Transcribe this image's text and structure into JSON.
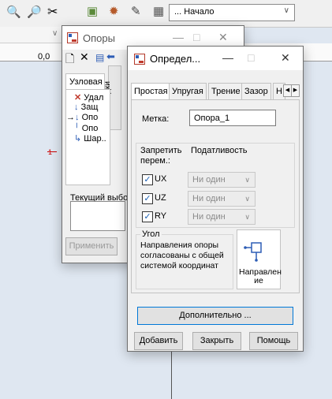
{
  "app": {
    "top_combo_value": "... Начало",
    "ruler_origin": "0,0",
    "axis_marker": "1"
  },
  "opory_window": {
    "title": "Опоры",
    "tab_label": "Узловая",
    "side_tab_label": "вкладки",
    "tree_items": [
      "Удал",
      "Защ",
      "Опо",
      "Опо",
      "Шар.."
    ],
    "tree_partial_right": [
      ":",
      "ен",
      ":",
      ":",
      ""
    ],
    "current_selection_label": "Текущий выбор",
    "apply_label": "Применить"
  },
  "opred_window": {
    "title": "Определ...",
    "tabs": [
      "Простая",
      "Упругая",
      "Трение",
      "Зазор",
      "Н"
    ],
    "label_field_label": "Метка:",
    "label_field_value": "Опора_1",
    "restrict_header": "Запретить перем.:",
    "compliance_header": "Податливость",
    "rows": [
      {
        "name": "UX",
        "checked": true,
        "value": "Ни один"
      },
      {
        "name": "UZ",
        "checked": true,
        "value": "Ни один"
      },
      {
        "name": "RY",
        "checked": true,
        "value": "Ни один"
      }
    ],
    "angle_label": "Угол",
    "angle_text": "Направления опоры согласованы с общей системой координат",
    "direction_button": "Направлен ие",
    "more_button": "Дополнительно ...",
    "add_button": "Добавить",
    "close_button": "Закрыть",
    "help_button": "Помощь"
  }
}
